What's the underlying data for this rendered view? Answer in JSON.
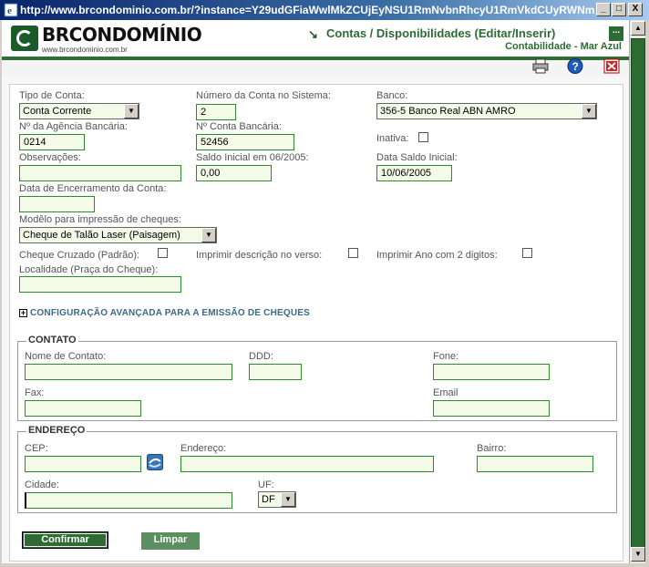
{
  "window": {
    "title": "http://www.brcondominio.com.br/?instance=Y29udGFiaWwlMkZCUjEyNSU1RmNvbnRhcyU1RmVkdCUyRWNmb...",
    "minimize": "_",
    "maximize": "□",
    "close": "X"
  },
  "header": {
    "logo_text": "BRCONDOMÍNIO",
    "logo_url": "www.brcondominio.com.br",
    "title": "Contas / Disponibilidades (Editar/Inserir)",
    "subtitle": "Contabilidade - Mar Azul",
    "menu_label": "..."
  },
  "toolbar": {
    "icons": [
      "printer-icon",
      "help-icon",
      "close-icon"
    ],
    "accent": "#2d6b33"
  },
  "form": {
    "tipo_conta": {
      "label": "Tipo de Conta:",
      "value": "Conta Corrente"
    },
    "numero_conta_sistema": {
      "label": "Número da Conta no Sistema:",
      "value": "2"
    },
    "banco": {
      "label": "Banco:",
      "value": "356-5 Banco Real ABN AMRO"
    },
    "agencia": {
      "label": "Nº da Agência Bancária:",
      "value": "0214"
    },
    "conta_bancaria": {
      "label": "Nº Conta Bancária:",
      "value": "52456"
    },
    "inativa": {
      "label": "Inativa:",
      "checked": false
    },
    "observacoes": {
      "label": "Observações:",
      "value": ""
    },
    "saldo_inicial": {
      "label": "Saldo Inicial em 06/2005:",
      "value": "0,00"
    },
    "data_saldo_inicial": {
      "label": "Data Saldo Inicial:",
      "value": "10/06/2005"
    },
    "data_encerramento": {
      "label": "Data de Encerramento da Conta:",
      "value": ""
    },
    "modelo_cheque": {
      "label": "Modêlo para impressão de cheques:",
      "value": "Cheque de Talão Laser (Paisagem)"
    },
    "cheque_cruzado": {
      "label": "Cheque Cruzado (Padrão):",
      "checked": false
    },
    "imprimir_verso": {
      "label": "Imprimir descrição no verso:",
      "checked": false
    },
    "imprimir_ano": {
      "label": "Imprimir Ano com 2 digitos:",
      "checked": false
    },
    "localidade": {
      "label": "Localidade (Praça do Cheque):",
      "value": ""
    },
    "config_avancada": {
      "toggle": "+",
      "label": "CONFIGURAÇÃO AVANÇADA PARA A EMISSÃO DE CHEQUES"
    }
  },
  "contato": {
    "legend": "CONTATO",
    "nome": {
      "label": "Nome de Contato:",
      "value": ""
    },
    "ddd": {
      "label": "DDD:",
      "value": ""
    },
    "fone": {
      "label": "Fone:",
      "value": ""
    },
    "fax": {
      "label": "Fax:",
      "value": ""
    },
    "email": {
      "label": "Email",
      "value": ""
    }
  },
  "endereco": {
    "legend": "ENDEREÇO",
    "cep": {
      "label": "CEP:",
      "value": ""
    },
    "endereco": {
      "label": "Endereço:",
      "value": ""
    },
    "bairro": {
      "label": "Bairro:",
      "value": ""
    },
    "cidade": {
      "label": "Cidade:",
      "value": ""
    },
    "uf": {
      "label": "UF:",
      "value": "DF"
    }
  },
  "actions": {
    "confirmar": "Confirmar",
    "limpar": "Limpar"
  }
}
